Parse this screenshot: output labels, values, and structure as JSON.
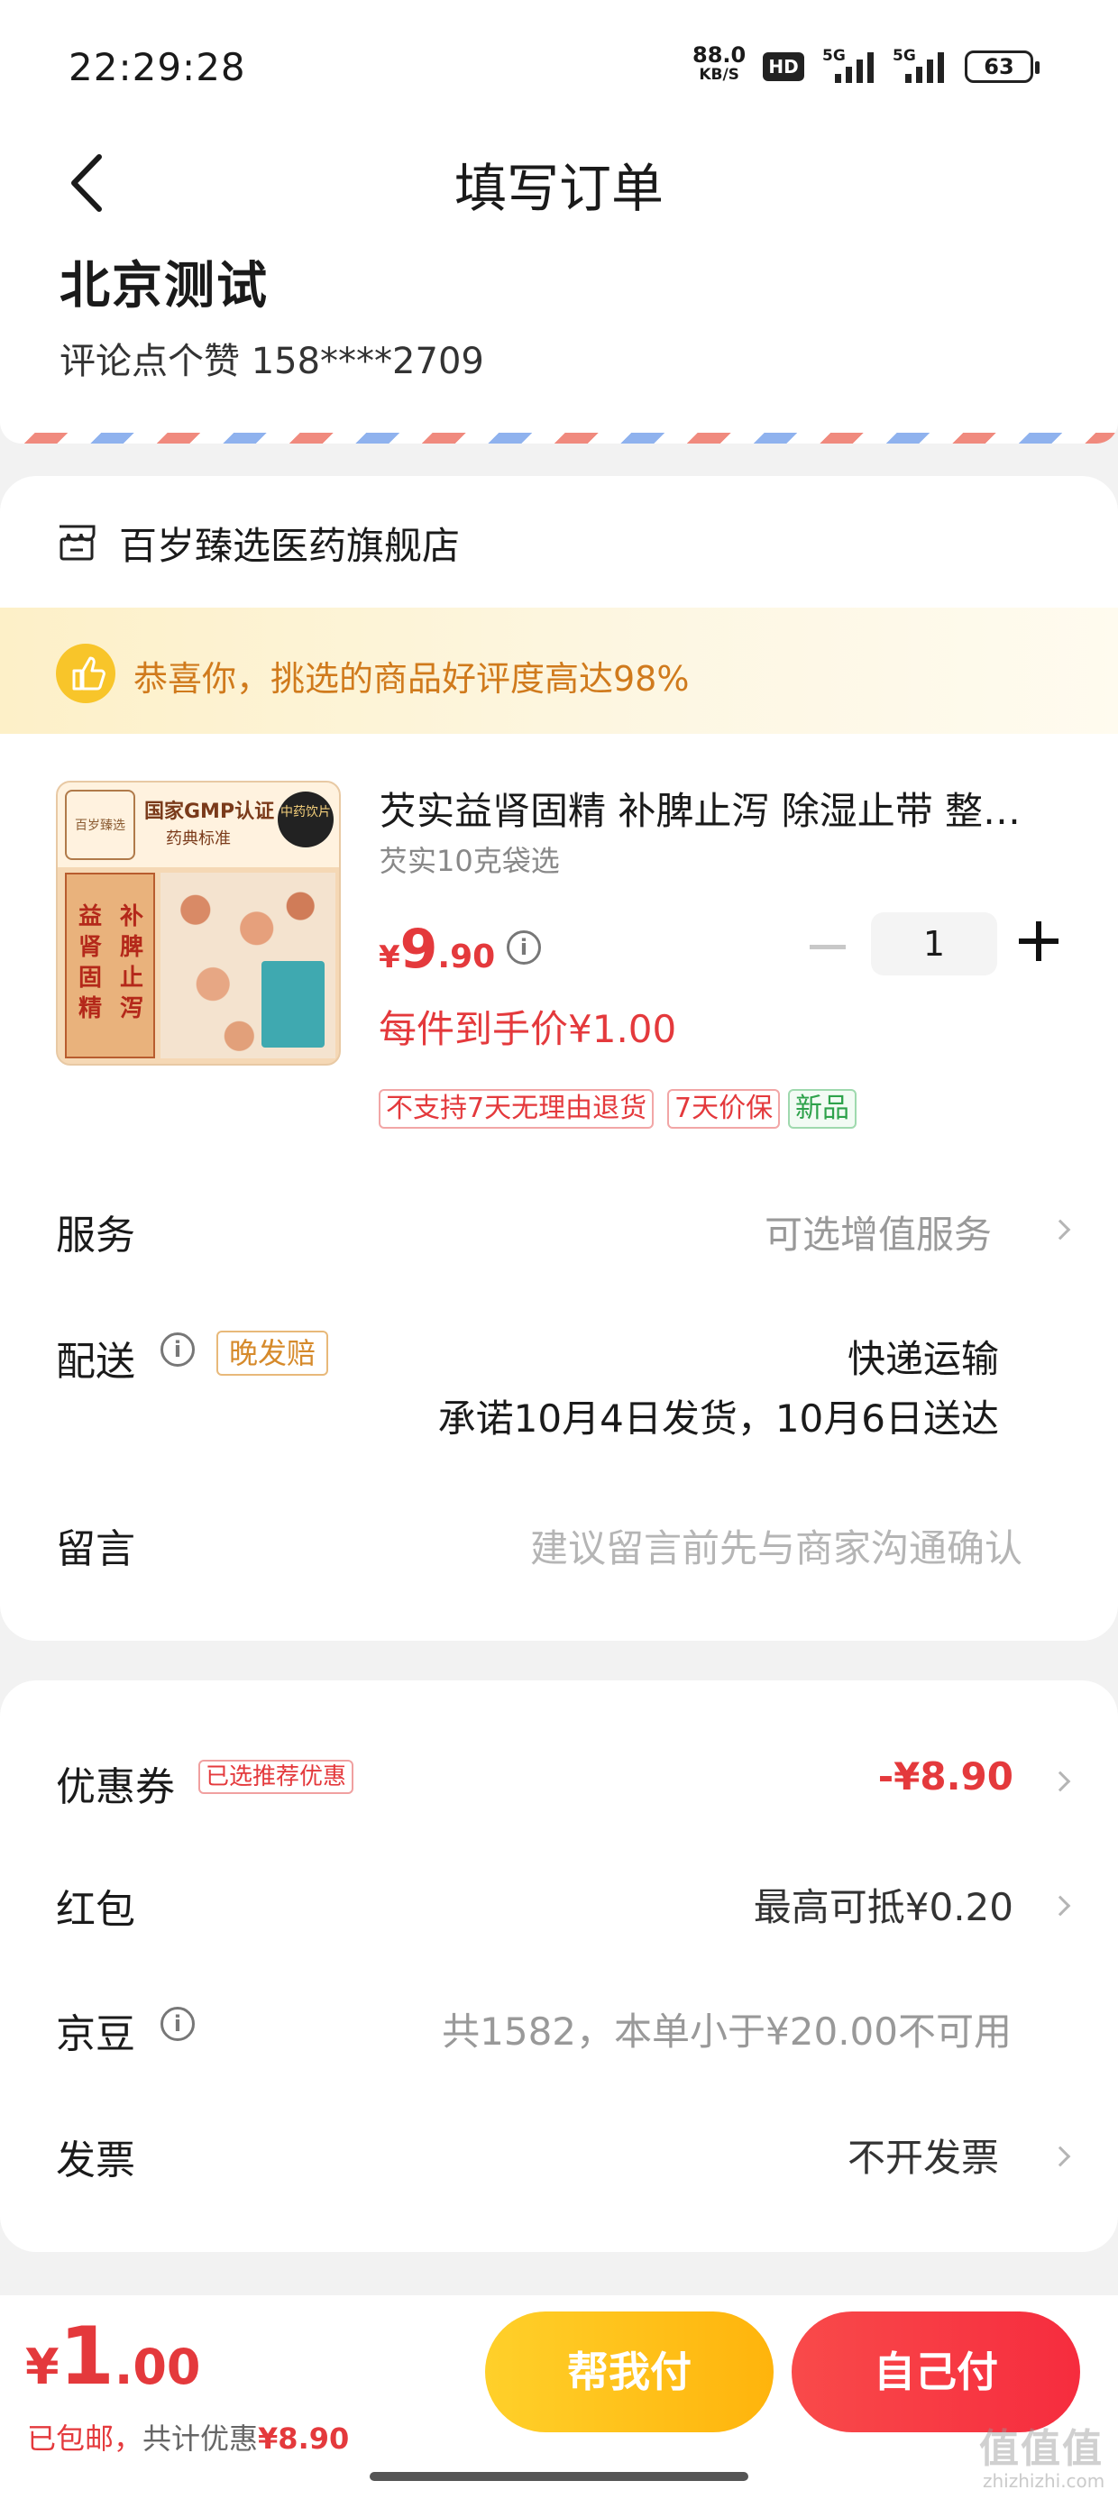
{
  "status_bar": {
    "time": "22:29:28",
    "net_speed_value": "88.0",
    "net_speed_unit": "KB/S",
    "hd": "HD",
    "sim1": "5G",
    "sim2": "5G",
    "battery": "63"
  },
  "nav": {
    "title": "填写订单"
  },
  "address": {
    "name": "北京测试",
    "contact": "评论点个赞  158****2709"
  },
  "shop": {
    "name": "百岁臻选医药旗舰店",
    "praise": "恭喜你，挑选的商品好评度高达98%"
  },
  "product": {
    "image_text": {
      "logo": "百岁臻选",
      "gmp": "国家GMP认证",
      "standard": "药典标准",
      "badge": "中药饮片",
      "col1": "益肾固精",
      "col2": "补脾止泻"
    },
    "title": "芡实益肾固精 补脾止泻 除湿止带 整…",
    "spec": "芡实10克袋选",
    "price_symbol": "¥",
    "price_int": "9",
    "price_dec": ".90",
    "quantity": "1",
    "unit_price": "每件到手价¥1.00",
    "tags": [
      "不支持7天无理由退货",
      "7天价保",
      "新品"
    ]
  },
  "service": {
    "label": "服务",
    "value": "可选增值服务"
  },
  "delivery": {
    "label": "配送",
    "badge": "晚发赔",
    "method": "快递运输",
    "promise": "承诺10月4日发货，10月6日送达"
  },
  "message": {
    "label": "留言",
    "placeholder": "建议留言前先与商家沟通确认"
  },
  "coupon": {
    "label": "优惠券",
    "tag": "已选推荐优惠",
    "value": "-¥8.90"
  },
  "red_packet": {
    "label": "红包",
    "value": "最高可抵¥0.20"
  },
  "jingdou": {
    "label": "京豆",
    "value": "共1582，本单小于¥20.00不可用"
  },
  "invoice": {
    "label": "发票",
    "value": "不开发票"
  },
  "bottom": {
    "total_symbol": "¥",
    "total_int": "1",
    "total_dec": ".00",
    "shipping": "已包邮，",
    "discount_label": "共计优惠",
    "discount_value": "¥8.90",
    "help_pay": "帮我付",
    "self_pay": "自己付"
  },
  "watermark": {
    "text": "值值值",
    "url": "zhizhizhi.com"
  },
  "colors": {
    "accent": "#e4393c",
    "orange": "#d07a1c",
    "yellow_btn": "#ffc21a"
  }
}
